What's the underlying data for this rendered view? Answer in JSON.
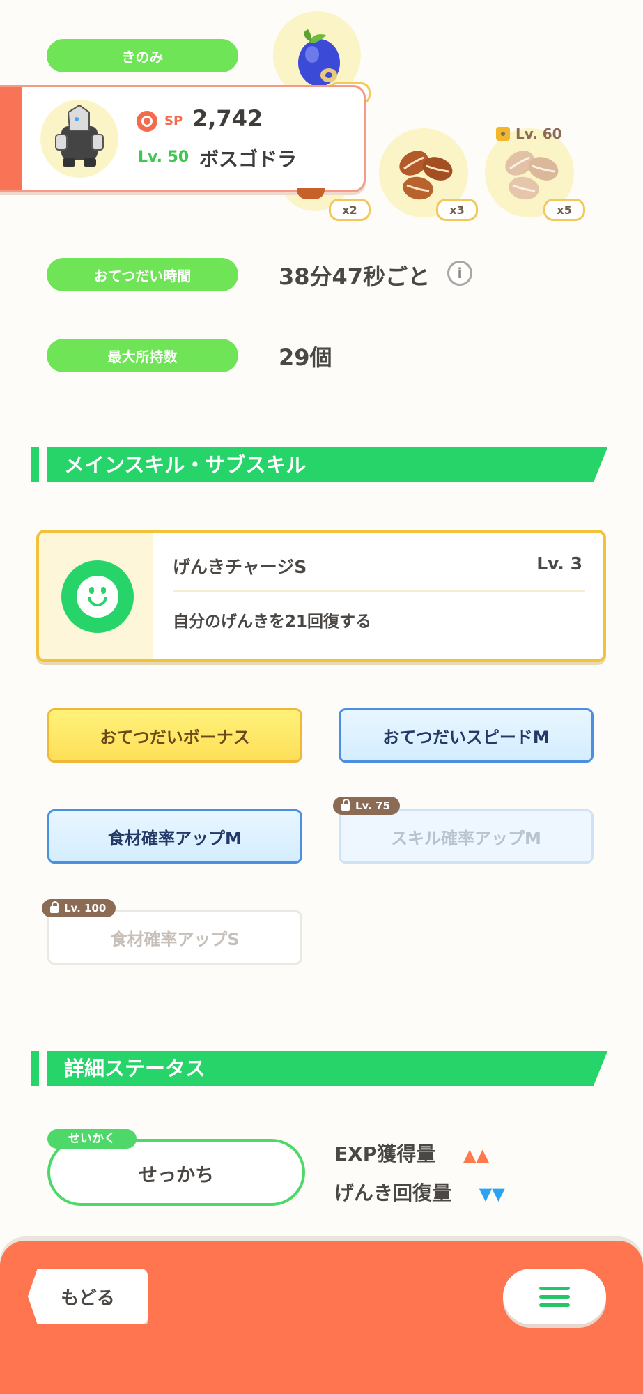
{
  "labels": {
    "berries": "きのみ",
    "help_time": "おてつだい時間",
    "max_carry": "最大所持数"
  },
  "values": {
    "help_time": "38分47秒ごと",
    "max_carry": "29個"
  },
  "pokemon": {
    "sp_label": "SP",
    "sp_value": "2,742",
    "level": "Lv. 50",
    "name": "ボスゴドラ"
  },
  "ingredients": [
    {
      "qty": "x2"
    },
    {
      "qty": "x3"
    },
    {
      "qty": "x5",
      "unlock": "Lv. 60"
    }
  ],
  "sections": {
    "skills": "メインスキル・サブスキル",
    "details": "詳細ステータス"
  },
  "main_skill": {
    "name": "げんきチャージS",
    "level": "Lv. 3",
    "description": "自分のげんきを21回復する"
  },
  "sub_skills": [
    {
      "label": "おてつだいボーナス"
    },
    {
      "label": "おてつだいスピードM"
    },
    {
      "label": "食材確率アップM"
    },
    {
      "label": "スキル確率アップM",
      "lock": "Lv. 75"
    },
    {
      "label": "食材確率アップS",
      "lock": "Lv. 100"
    }
  ],
  "nature": {
    "tag": "せいかく",
    "value": "せっかち"
  },
  "stats": [
    {
      "label": "EXP獲得量",
      "arrows": "▲▲",
      "color": "#ff7a4a"
    },
    {
      "label": "げんき回復量",
      "arrows": "▼▼",
      "color": "#2aa3f5"
    }
  ],
  "footer": {
    "back": "もどる"
  },
  "colors": {
    "accent_green": "#26d46a",
    "pill_green": "#6ee456",
    "footer_orange": "#ff7550"
  }
}
